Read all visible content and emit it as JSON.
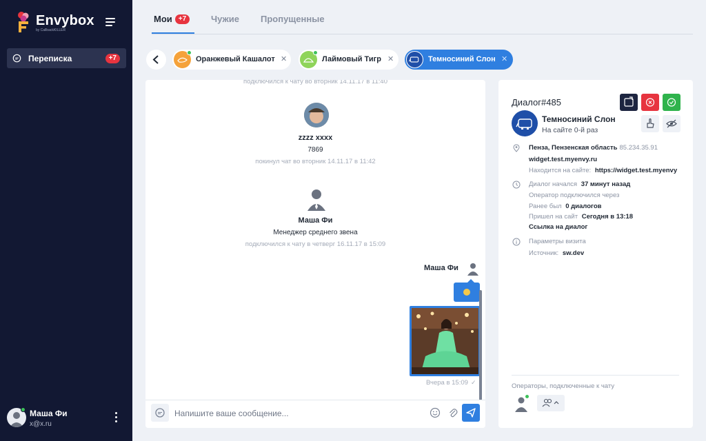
{
  "brand": {
    "name": "Envybox",
    "sub": "by CallbackKILLER"
  },
  "sidebar": {
    "items": [
      {
        "label": "Переписка",
        "badge": "+7"
      }
    ],
    "user": {
      "name": "Маша Фи",
      "email": "x@x.ru"
    }
  },
  "tabs": [
    {
      "label": "Мои",
      "badge": "+7",
      "active": true
    },
    {
      "label": "Чужие"
    },
    {
      "label": "Пропущенные"
    }
  ],
  "chats": [
    {
      "name": "Оранжевый Кашалот",
      "color": "#f5a23a"
    },
    {
      "name": "Лаймовый Тигр",
      "color": "#8fd45a"
    },
    {
      "name": "Темносиний Слон",
      "color": "#1f4fa8",
      "active": true
    }
  ],
  "chat": {
    "top_cut": "подключился к чату во вторник 14.11.17 в 11:40",
    "events": [
      {
        "name": "zzzz xxxx",
        "role": "7869",
        "time": "покинул чат во вторник 14.11.17 в 11:42"
      },
      {
        "name": "Маша Фи",
        "role": "Менеджер среднего звена",
        "time": "подключился к чату в четверг 16.11.17 в 15:09"
      }
    ],
    "operator_name": "Маша Фи",
    "last_time": "Вчера в 15:09",
    "composer_placeholder": "Напишите ваше сообщение..."
  },
  "dialog": {
    "title": "Диалог#485",
    "visitor": {
      "name": "Темносиний Слон",
      "seen": "На сайте 0-й раз"
    },
    "location": "Пенза, Пензенская область",
    "ip": "85.234.35.91",
    "site": "widget.test.myenvy.ru",
    "on_site_label": "Находится на сайте:",
    "on_site_value": "https://widget.test.myenvy",
    "started_label": "Диалог начался",
    "started_value": "37 минут назад",
    "op_connected_label": "Оператор подключился через",
    "before_label": "Ранее был",
    "before_value": "0 диалогов",
    "came_label": "Пришел на сайт",
    "came_value": "Сегодня в 13:18",
    "link_label": "Ссылка на диалог",
    "params_label": "Параметры визита",
    "source_label": "Источник:",
    "source_value": "sw.dev",
    "ops_label": "Операторы, подключенные к чату"
  },
  "colors": {
    "sidebar": "#121833",
    "accent": "#2f7fe0",
    "danger": "#e7343f",
    "success": "#2fb34c",
    "dark_btn": "#1d2540"
  }
}
